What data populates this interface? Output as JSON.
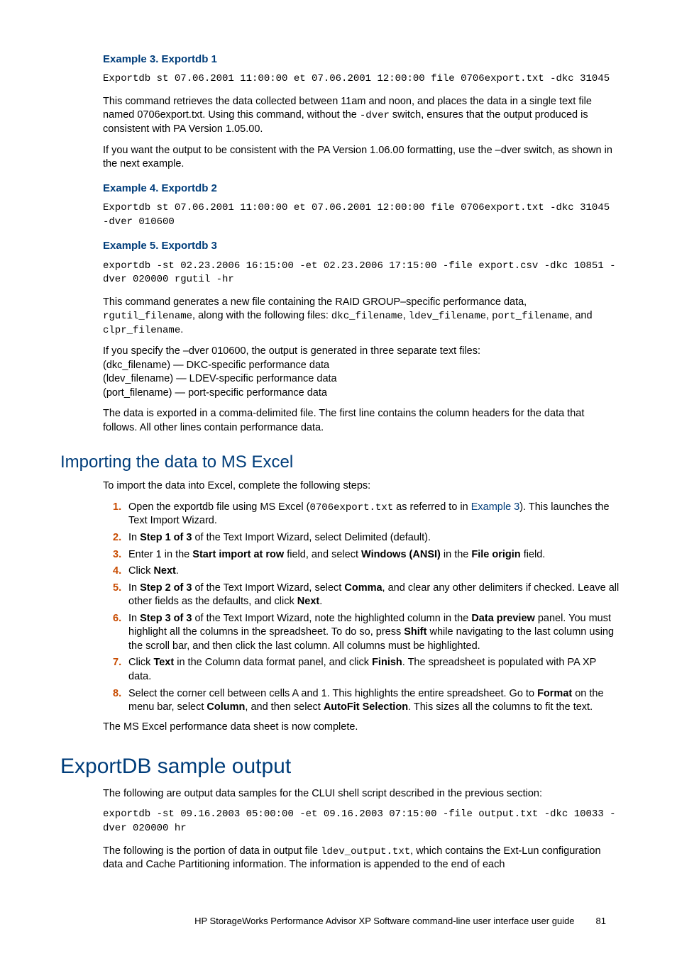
{
  "indent": {
    "ex3_title": "Example 3. Exportdb 1",
    "ex3_code": "Exportdb st 07.06.2001 11:00:00 et 07.06.2001 12:00:00 file 0706export.txt -dkc 31045",
    "ex3_p1a": "This command retrieves the data collected between 11am and noon, and places the data in a single text file named 0706export.txt. Using this command, without the ",
    "ex3_p1b": "-dver",
    "ex3_p1c": " switch, ensures that the output produced is consistent with PA Version 1.05.00.",
    "ex3_p2": "If you want the output to be consistent with the PA Version 1.06.00 formatting, use the –dver switch, as shown in the next example.",
    "ex4_title": "Example 4. Exportdb 2",
    "ex4_code": "Exportdb st 07.06.2001 11:00:00 et 07.06.2001 12:00:00 file 0706export.txt -dkc 31045 -dver 010600",
    "ex5_title": "Example 5. Exportdb 3",
    "ex5_code": "exportdb -st 02.23.2006 16:15:00 -et 02.23.2006 17:15:00 -file export.csv -dkc 10851 -dver 020000 rgutil -hr",
    "ex5_p1a": "This command generates a new file containing the RAID GROUP–specific performance data, ",
    "ex5_p1b": "rgutil_filename",
    "ex5_p1c": ", along with the following files: ",
    "ex5_p1d": "dkc_filename",
    "ex5_p1e": ", ",
    "ex5_p1f": "ldev_filename",
    "ex5_p1g": ", ",
    "ex5_p1h": "port_filename",
    "ex5_p1i": ", and ",
    "ex5_p1j": "clpr_filename",
    "ex5_p1k": ".",
    "ex5_p2_l1": "If you specify the –dver 010600, the output is generated in three separate text files:",
    "ex5_p2_l2": "(dkc_filename) — DKC-specific performance data",
    "ex5_p2_l3": "(ldev_filename) — LDEV-specific performance data",
    "ex5_p2_l4": "(port_filename) — port-specific performance data",
    "ex5_p3": "The data is exported in a comma-delimited file. The first line contains the column headers for the data that follows. All other lines contain performance data."
  },
  "sec2": {
    "title": "Importing the data to MS Excel",
    "intro": "To import the data into Excel, complete the following steps:",
    "steps": [
      {
        "n": "1.",
        "pre": "Open the exportdb file using MS Excel (",
        "code": "0706export.txt",
        "mid": " as referred to in ",
        "link": "Example 3",
        "post": "). This launches the Text Import Wizard."
      },
      {
        "n": "2.",
        "pre": "In ",
        "b1": "Step 1 of 3",
        "post": " of the Text Import Wizard, select Delimited (default)."
      },
      {
        "n": "3.",
        "pre": "Enter 1 in the ",
        "b1": "Start import at row",
        "mid": " field, and select ",
        "b2": "Windows (ANSI)",
        "mid2": " in the ",
        "b3": "File origin",
        "post": " field."
      },
      {
        "n": "4.",
        "pre": "Click ",
        "b1": "Next",
        "post": "."
      },
      {
        "n": "5.",
        "pre": "In ",
        "b1": "Step 2 of 3",
        "mid": " of the Text Import Wizard, select ",
        "b2": "Comma",
        "post": ", and clear any other delimiters if checked. Leave all other fields as the defaults, and click ",
        "b3": "Next",
        "post2": "."
      },
      {
        "n": "6.",
        "pre": "In ",
        "b1": "Step 3 of 3",
        "mid": " of the Text Import Wizard, note the highlighted column in the ",
        "b2": "Data preview",
        "mid2": " panel. You must highlight all the columns in the spreadsheet. To do so, press ",
        "b3": "Shift",
        "post": " while navigating to the last column using the scroll bar, and then click the last column. All columns must be highlighted."
      },
      {
        "n": "7.",
        "pre": "Click ",
        "b1": "Text",
        "mid": " in the Column data format panel, and click ",
        "b2": "Finish",
        "post": ". The spreadsheet is populated with PA XP data."
      },
      {
        "n": "8.",
        "pre": "Select the corner cell between cells A and 1. This highlights the entire spreadsheet. Go to ",
        "b1": "Format",
        "mid": " on the menu bar, select ",
        "b2": "Column",
        "mid2": ", and then select ",
        "b3": "AutoFit Selection",
        "post": ". This sizes all the columns to fit the text."
      }
    ],
    "outro": "The MS Excel performance data sheet is now complete."
  },
  "sec3": {
    "title": "ExportDB sample output",
    "p1": "The following are output data samples for the CLUI shell script described in the previous section:",
    "code": "exportdb -st 09.16.2003 05:00:00 -et 09.16.2003 07:15:00 -file output.txt -dkc 10033 -dver 020000 hr",
    "p2a": "The following is the portion of data in output file ",
    "p2b": "ldev_output.txt",
    "p2c": ", which contains the Ext-Lun configuration data and Cache Partitioning information. The information is appended to the end of each"
  },
  "footer": {
    "text": "HP StorageWorks Performance Advisor XP Software command-line user interface user guide",
    "page": "81"
  }
}
